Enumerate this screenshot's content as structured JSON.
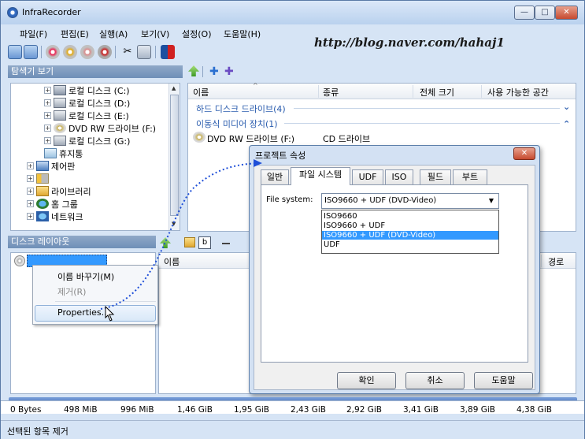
{
  "window": {
    "title": "InfraRecorder",
    "min": "—",
    "max": "□",
    "close": "✕"
  },
  "menu": [
    "파일(F)",
    "편집(E)",
    "실행(A)",
    "보기(V)",
    "설정(O)",
    "도움말(H)"
  ],
  "watermark": "http://blog.naver.com/hahaj1",
  "explorer": {
    "header": "탐색기 보기",
    "items": [
      {
        "label": "로컬 디스크 (C:)",
        "icon": "drive-icon"
      },
      {
        "label": "로컬 디스크 (D:)",
        "icon": "drive-icon"
      },
      {
        "label": "로컬 디스크 (E:)",
        "icon": "drive-icon"
      },
      {
        "label": "DVD RW 드라이브 (F:)",
        "icon": "dvd-drive-icon"
      },
      {
        "label": "로컬 디스크 (G:)",
        "icon": "drive-icon"
      },
      {
        "label": "휴지통",
        "icon": "recycle-bin-icon"
      },
      {
        "label": "제어판",
        "icon": "control-panel-icon"
      },
      {
        "label": "",
        "icon": "user-folder-icon"
      },
      {
        "label": "라이브러리",
        "icon": "library-icon"
      },
      {
        "label": "홈 그룹",
        "icon": "homegroup-icon"
      },
      {
        "label": "네트워크",
        "icon": "network-icon"
      }
    ]
  },
  "filelist": {
    "columns": [
      "이름",
      "종류",
      "전체 크기",
      "사용 가능한 공간"
    ],
    "groups": [
      {
        "label": "하드 디스크 드라이브(4)",
        "chevron": "⌄"
      },
      {
        "label": "이동식 미디어 장치(1)",
        "chevron": "⌃"
      }
    ],
    "rows": [
      {
        "name": "DVD RW 드라이브 (F:)",
        "type": "CD 드라이브"
      }
    ]
  },
  "disc_layout": {
    "header": "디스크 레이아웃",
    "col_name": "이름",
    "col_path": "경로"
  },
  "context_menu": {
    "rename": "이름 바꾸기(M)",
    "remove": "제거(R)",
    "properties": "Properties..."
  },
  "dialog": {
    "title": "프로젝트 속성",
    "tabs": [
      "일반",
      "파일 시스템",
      "UDF",
      "ISO",
      "필드",
      "부트"
    ],
    "active_tab": "파일 시스템",
    "fs_label": "File system:",
    "fs_value": "ISO9660 + UDF (DVD-Video)",
    "fs_options": [
      "ISO9660",
      "ISO9660 + UDF",
      "ISO9660 + UDF (DVD-Video)",
      "UDF"
    ],
    "fs_selected_index": 2,
    "ok": "확인",
    "cancel": "취소",
    "help": "도움말"
  },
  "capacity": {
    "labels": [
      "0 Bytes",
      "498 MiB",
      "996 MiB",
      "1,46 GiB",
      "1,95 GiB",
      "2,43 GiB",
      "2,92 GiB",
      "3,41 GiB",
      "3,89 GiB",
      "4,38 GiB"
    ]
  },
  "status": "선택된 항목 제거"
}
